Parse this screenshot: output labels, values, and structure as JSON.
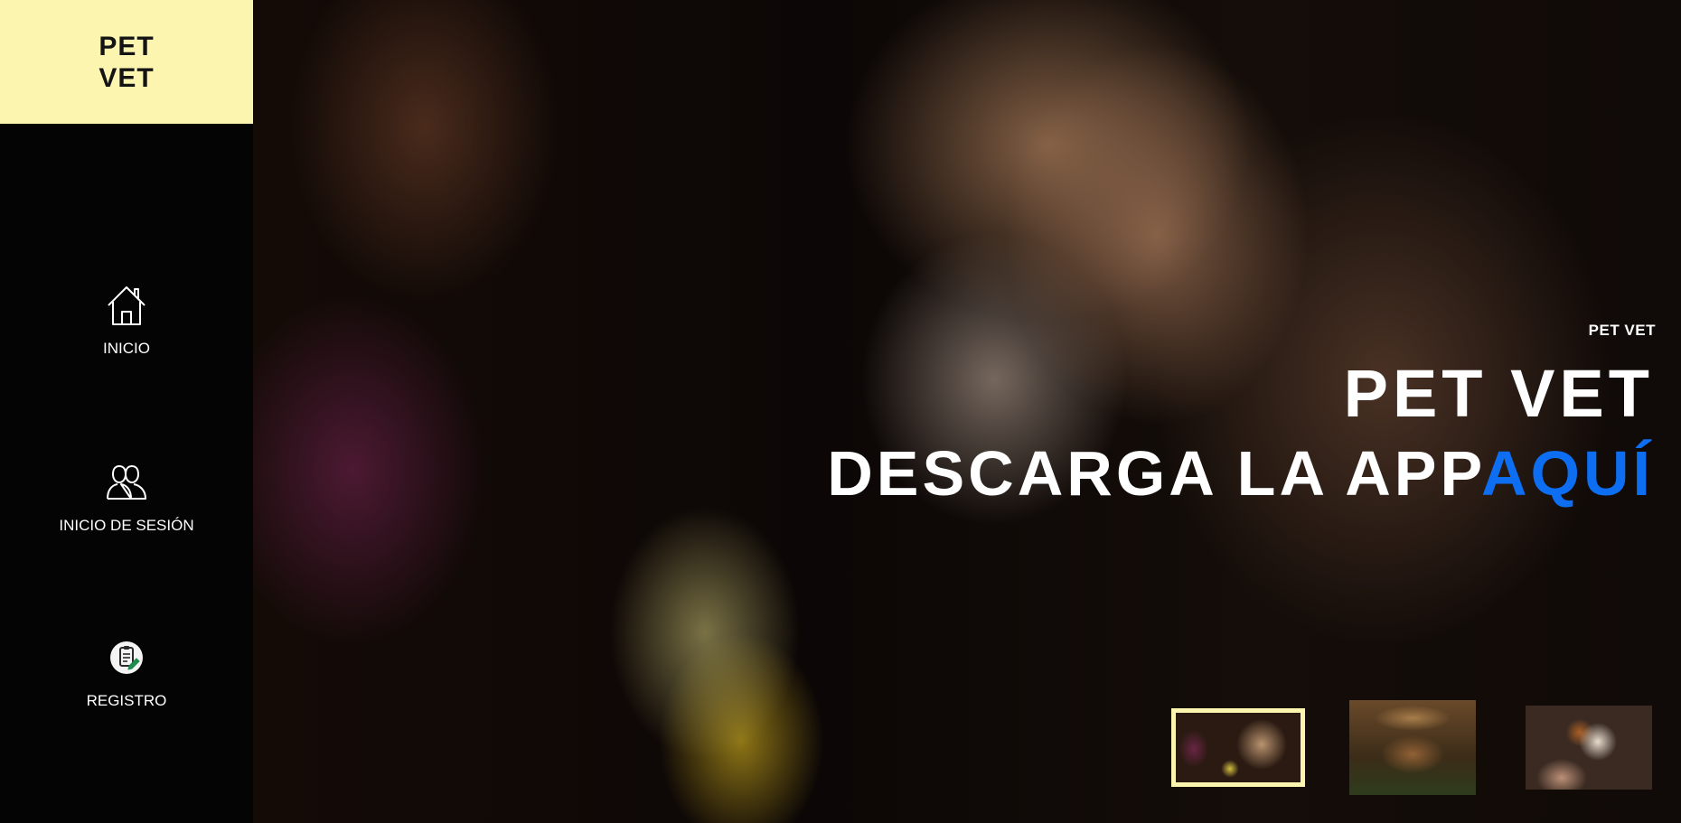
{
  "sidebar": {
    "logo_line1": "PET",
    "logo_line2": "VET",
    "items": [
      {
        "label": "INICIO",
        "icon": "home-icon"
      },
      {
        "label": "INICIO DE SESIÓN",
        "icon": "users-icon"
      },
      {
        "label": "REGISTRO",
        "icon": "clipboard-icon"
      }
    ]
  },
  "hero": {
    "small_title": "PET VET",
    "title": "PET VET",
    "subtitle_main": "DESCARGA LA APP",
    "subtitle_accent": "AQUÍ"
  },
  "thumbnails": [
    {
      "subject": "dog-with-flowers",
      "selected": true
    },
    {
      "subject": "puppies-in-basket",
      "selected": false
    },
    {
      "subject": "cat",
      "selected": false
    }
  ],
  "colors": {
    "logo_bg": "#fcf5b0",
    "sidebar_bg": "#050404",
    "accent_blue": "#0d6ef2",
    "thumb_selected_border": "#fcf5b0"
  }
}
